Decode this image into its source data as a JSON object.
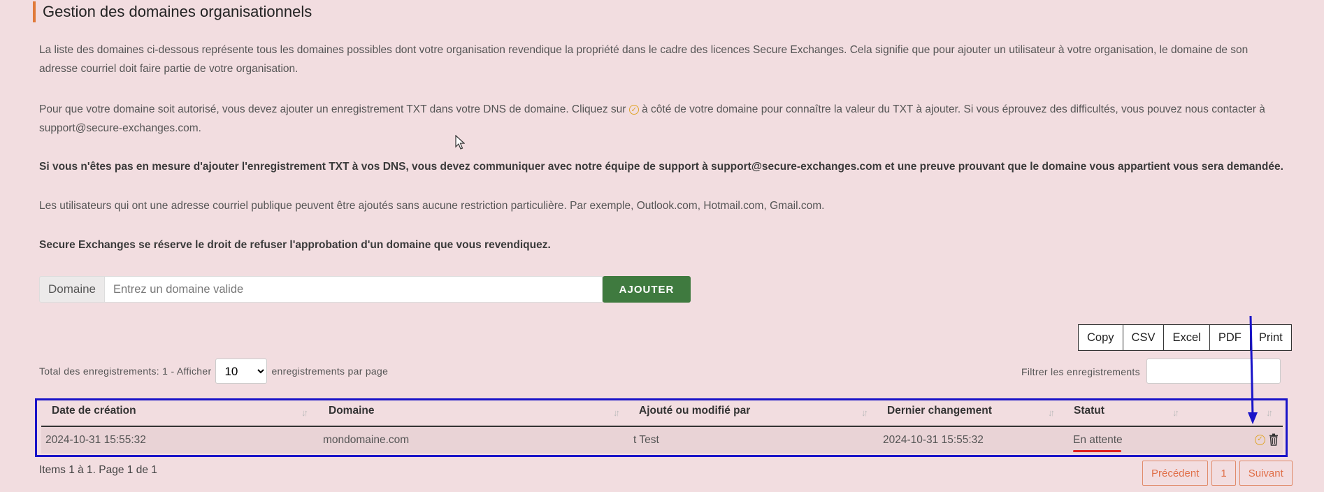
{
  "page": {
    "title": "Gestion des domaines organisationnels",
    "para1": "La liste des domaines ci-dessous représente tous les domaines possibles dont votre organisation revendique la propriété dans le cadre des licences Secure Exchanges. Cela signifie que pour ajouter un utilisateur à votre organisation, le domaine de son adresse courriel doit faire partie de votre organisation.",
    "para2_before": "Pour que votre domaine soit autorisé, vous devez ajouter un enregistrement TXT dans votre DNS de domaine. Cliquez sur ",
    "para2_after": " à côté de votre domaine pour connaître la valeur du TXT à ajouter. Si vous éprouvez des difficultés, vous pouvez nous contacter à support@secure-exchanges.com.",
    "para3": "Si vous n'êtes pas en mesure d'ajouter l'enregistrement TXT à vos DNS, vous devez communiquer avec notre équipe de support à support@secure-exchanges.com et une preuve prouvant que le domaine vous appartient vous sera demandée.",
    "para4": "Les utilisateurs qui ont une adresse courriel publique peuvent être ajoutés sans aucune restriction particulière. Par exemple, Outlook.com, Hotmail.com, Gmail.com.",
    "para5": "Secure Exchanges se réserve le droit de refuser l'approbation d'un domaine que vous revendiquez."
  },
  "domain_form": {
    "label": "Domaine",
    "placeholder": "Entrez un domaine valide",
    "value": "",
    "add_button": "AJOUTER"
  },
  "export_buttons": [
    "Copy",
    "CSV",
    "Excel",
    "PDF",
    "Print"
  ],
  "table_controls": {
    "total_prefix": "Total des enregistrements: 1 - Afficher",
    "page_size": "10",
    "page_size_options": [
      "10"
    ],
    "total_suffix": "enregistrements par page",
    "filter_label": "Filtrer les enregistrements",
    "filter_value": ""
  },
  "table": {
    "headers": [
      "Date de création",
      "Domaine",
      "Ajouté ou modifié par",
      "Dernier changement",
      "Statut"
    ],
    "rows": [
      {
        "created": "2024-10-31 15:55:32",
        "domain": "mondomaine.com",
        "modified_by": "t Test",
        "last_change": "2024-10-31 15:55:32",
        "status": "En attente"
      }
    ]
  },
  "footer": {
    "items_info": "Items 1 à 1. Page 1 de 1",
    "prev": "Précédent",
    "page": "1",
    "next": "Suivant"
  },
  "colors": {
    "background": "#f2dde0",
    "accent_green": "#3f7a3f",
    "highlight_blue": "#1a14c8",
    "status_underline": "#e02020",
    "check_orange": "#e0a52a",
    "pager_orange": "#e0704a"
  },
  "icons": {
    "verify": "check-circle-icon",
    "delete": "trash-icon",
    "sort": "sort-arrows-icon",
    "cursor": "mouse-cursor-icon",
    "annotation": "arrow-down-icon"
  }
}
